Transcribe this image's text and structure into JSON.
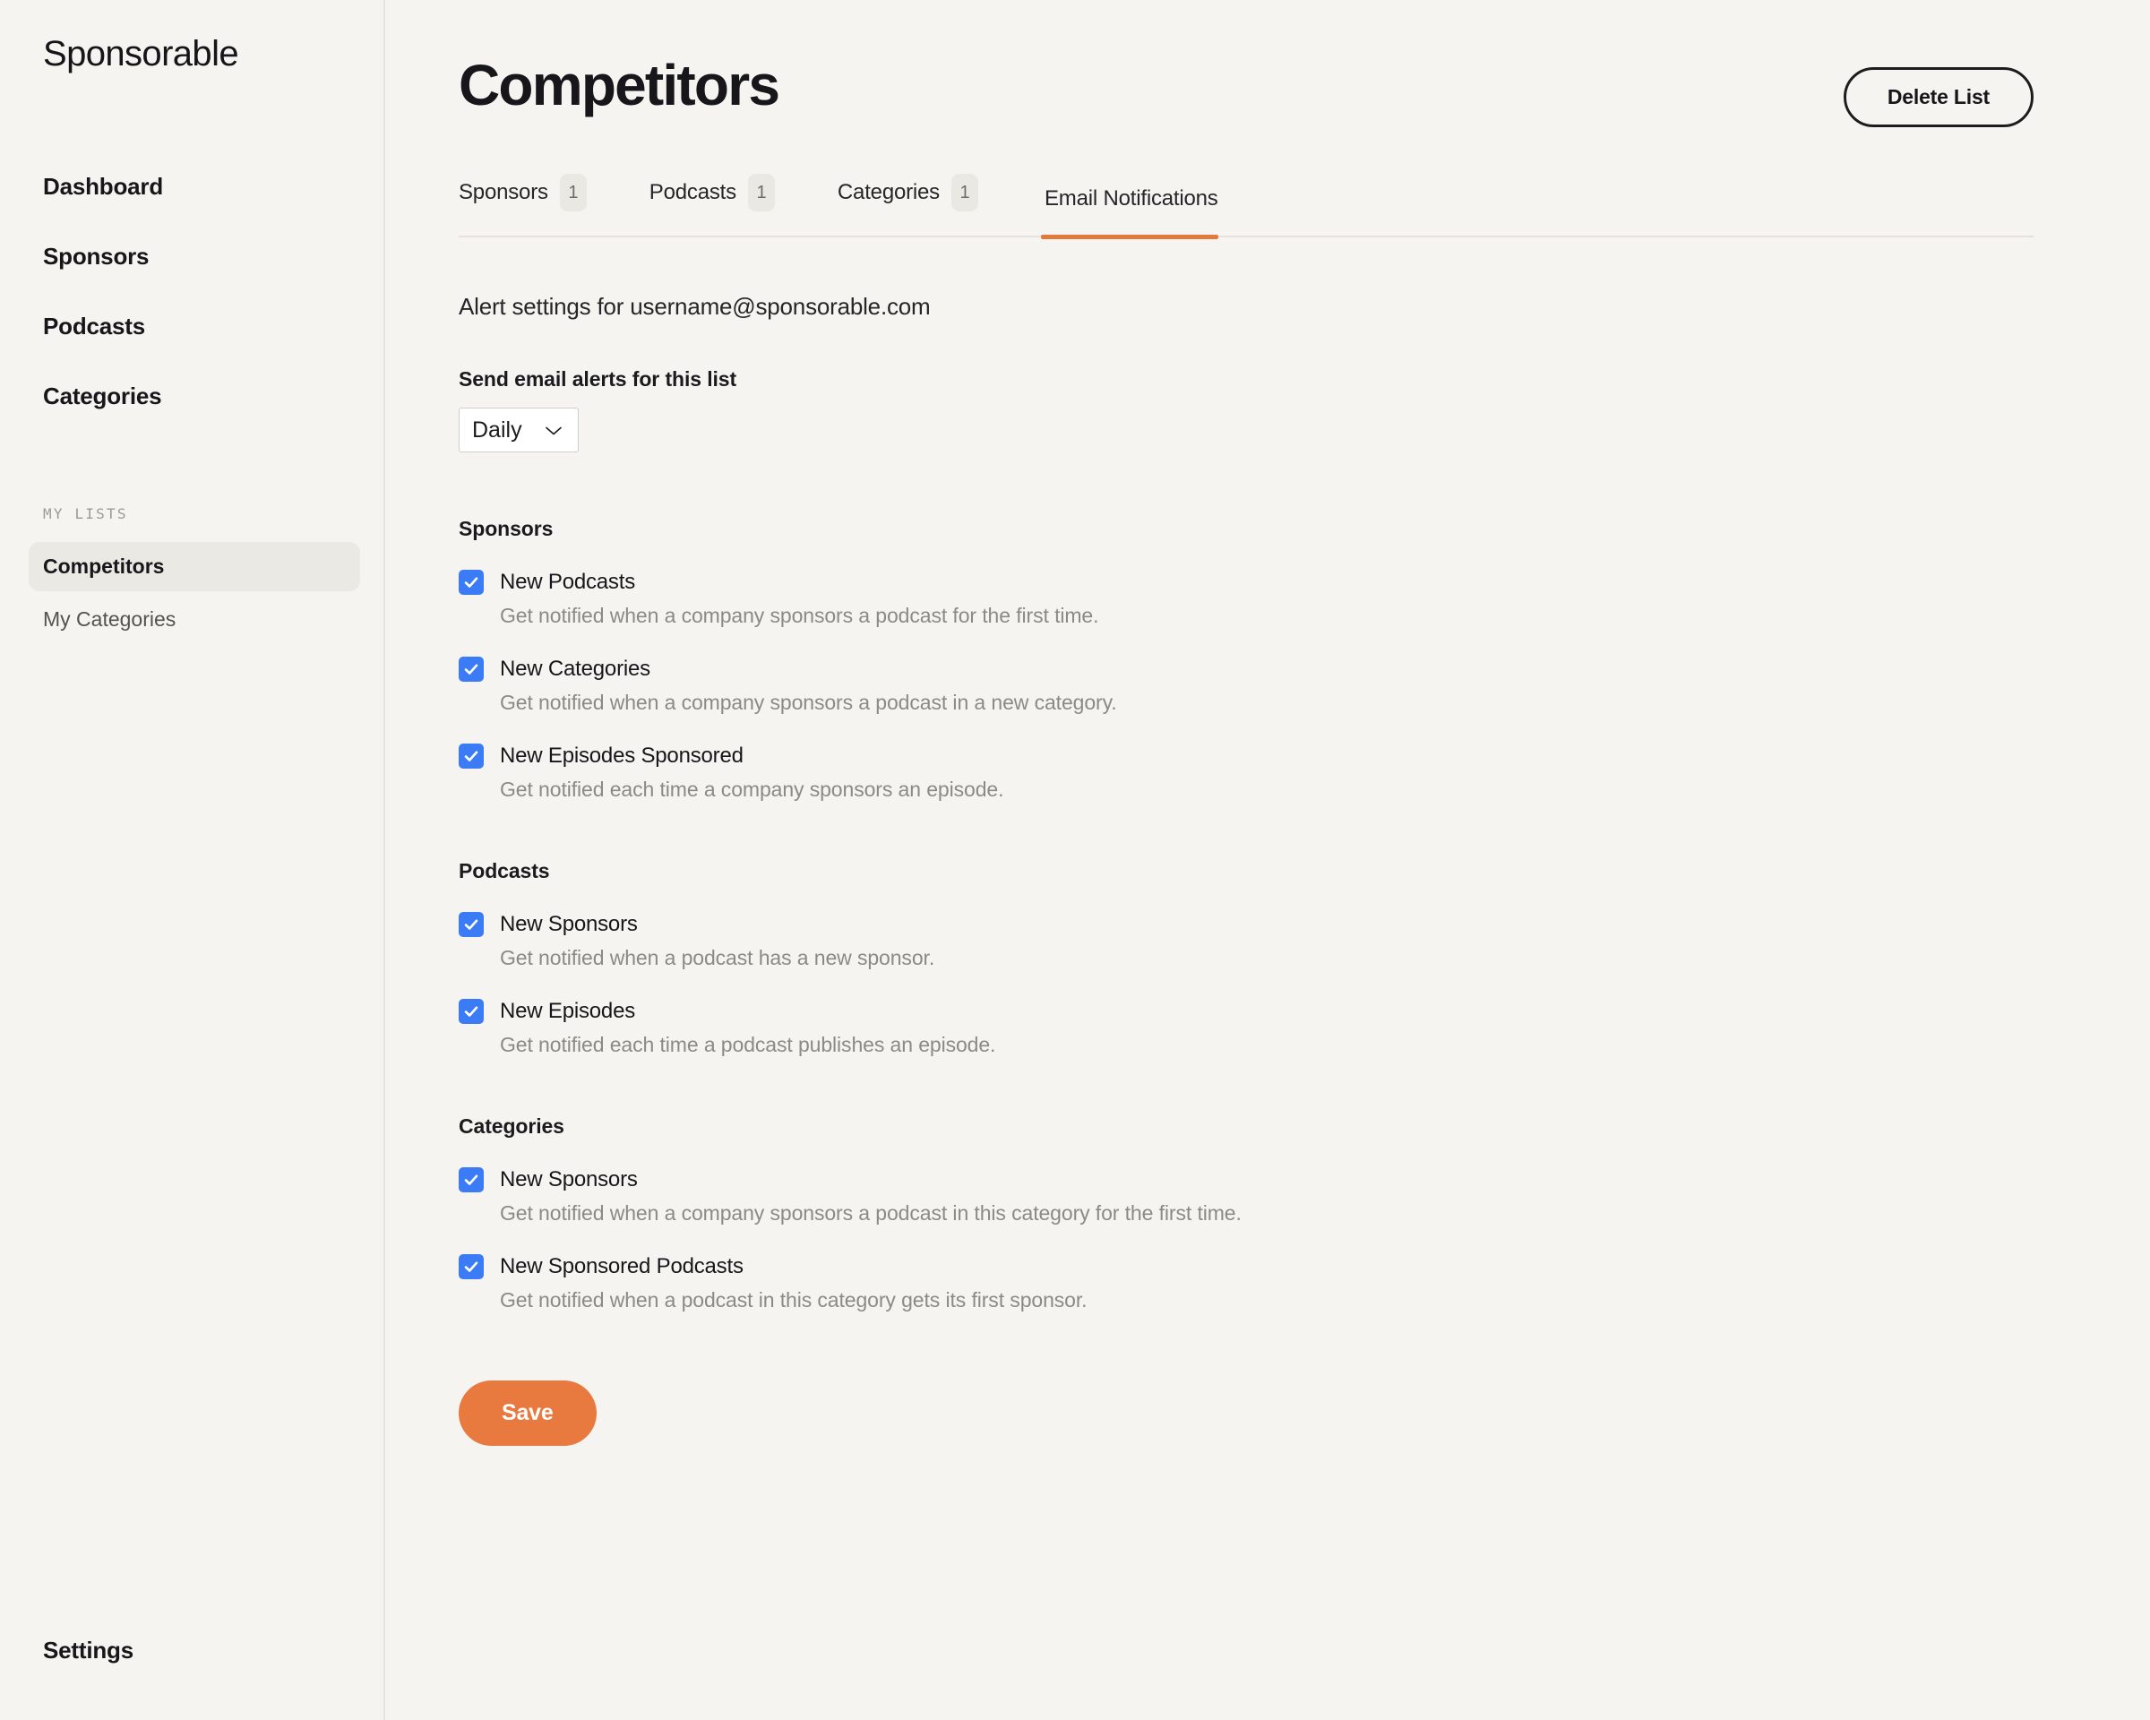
{
  "brand": "Sponsorable",
  "sidebar": {
    "nav": [
      {
        "label": "Dashboard"
      },
      {
        "label": "Sponsors"
      },
      {
        "label": "Podcasts"
      },
      {
        "label": "Categories"
      }
    ],
    "lists_label": "MY LISTS",
    "lists": [
      {
        "label": "Competitors",
        "active": true
      },
      {
        "label": "My Categories",
        "active": false
      }
    ],
    "settings_label": "Settings"
  },
  "header": {
    "title": "Competitors",
    "delete_label": "Delete List"
  },
  "tabs": [
    {
      "label": "Sponsors",
      "count": "1",
      "active": false
    },
    {
      "label": "Podcasts",
      "count": "1",
      "active": false
    },
    {
      "label": "Categories",
      "count": "1",
      "active": false
    },
    {
      "label": "Email Notifications",
      "count": null,
      "active": true
    }
  ],
  "main": {
    "alert_line": "Alert settings for username@sponsorable.com",
    "frequency_label": "Send email alerts for this list",
    "frequency_value": "Daily",
    "frequency_options": [
      "Daily"
    ],
    "save_label": "Save"
  },
  "groups": [
    {
      "title": "Sponsors",
      "options": [
        {
          "label": "New Podcasts",
          "desc": "Get notified when a company sponsors a podcast for the first time.",
          "checked": true
        },
        {
          "label": "New Categories",
          "desc": "Get notified when a company sponsors a podcast in a new category.",
          "checked": true
        },
        {
          "label": "New Episodes Sponsored",
          "desc": "Get notified each time a company sponsors an episode.",
          "checked": true
        }
      ]
    },
    {
      "title": "Podcasts",
      "options": [
        {
          "label": "New Sponsors",
          "desc": "Get notified when a podcast has a new sponsor.",
          "checked": true
        },
        {
          "label": "New Episodes",
          "desc": "Get notified each time a podcast publishes an episode.",
          "checked": true
        }
      ]
    },
    {
      "title": "Categories",
      "options": [
        {
          "label": "New Sponsors",
          "desc": "Get notified when a company sponsors a podcast in this category for the first time.",
          "checked": true
        },
        {
          "label": "New Sponsored Podcasts",
          "desc": "Get notified when a podcast in this category gets its first sponsor.",
          "checked": true
        }
      ]
    }
  ],
  "colors": {
    "accent": "#E8793F",
    "checkbox": "#3B7CF6",
    "background": "#F5F4F0",
    "active_pill": "#EBE9E3"
  }
}
